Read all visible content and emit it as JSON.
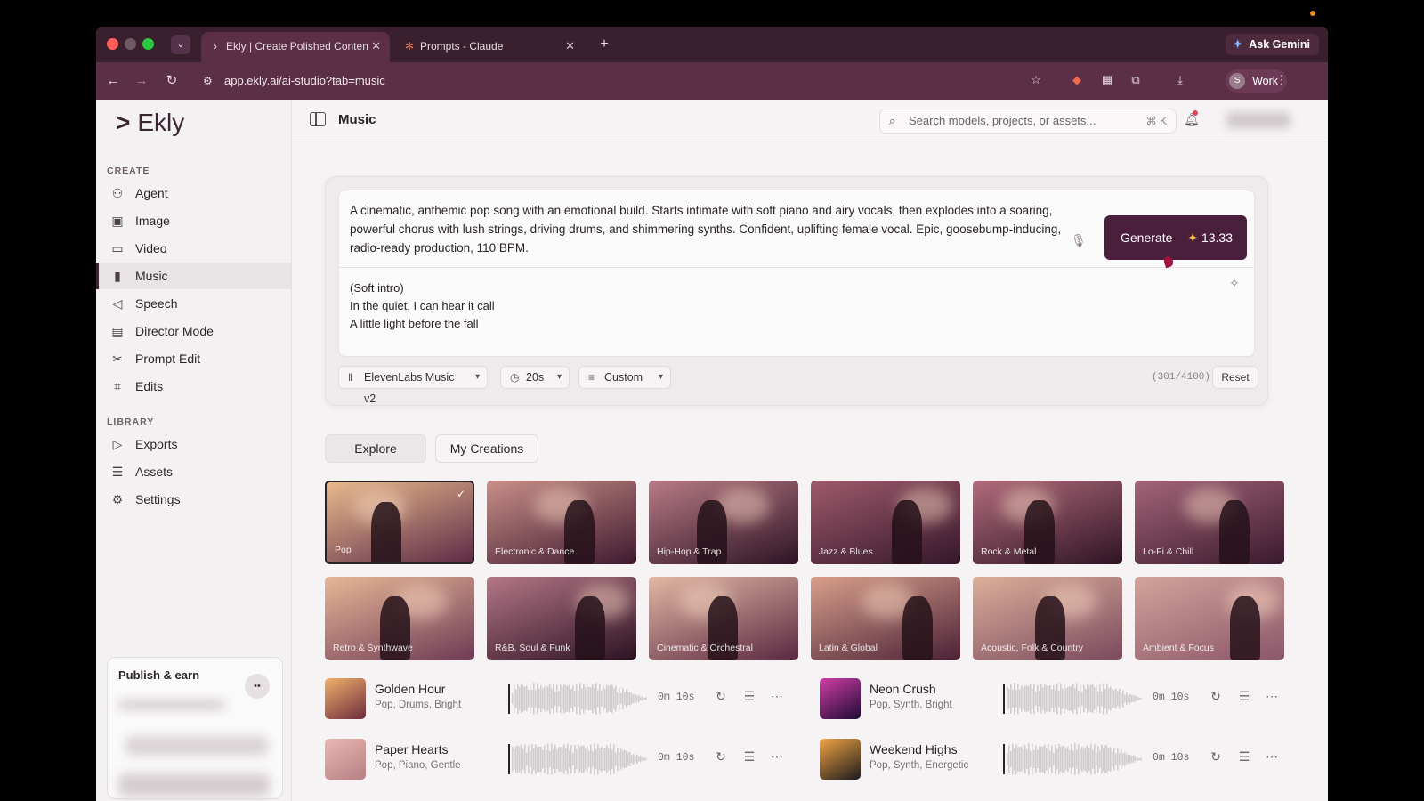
{
  "browser": {
    "tabs": [
      {
        "title": "Ekly | Create Polished Content",
        "icon": "ekly-favicon"
      },
      {
        "title": "Prompts - Claude",
        "icon": "claude-favicon"
      }
    ],
    "gemini_label": "Ask Gemini",
    "url": "app.ekly.ai/ai-studio?tab=music",
    "profile_label": "Work",
    "profile_initial": "S"
  },
  "sidebar": {
    "logo": "Ekly",
    "create_title": "CREATE",
    "create_items": [
      {
        "label": "Agent",
        "icon": "robot-icon"
      },
      {
        "label": "Image",
        "icon": "image-icon"
      },
      {
        "label": "Video",
        "icon": "video-icon"
      },
      {
        "label": "Music",
        "icon": "waveform-icon",
        "active": true
      },
      {
        "label": "Speech",
        "icon": "speech-icon"
      },
      {
        "label": "Director Mode",
        "icon": "clapperboard-icon"
      },
      {
        "label": "Prompt Edit",
        "icon": "scissors-icon"
      },
      {
        "label": "Edits",
        "icon": "crop-icon"
      }
    ],
    "library_title": "LIBRARY",
    "library_items": [
      {
        "label": "Exports",
        "icon": "play-icon"
      },
      {
        "label": "Assets",
        "icon": "database-icon"
      },
      {
        "label": "Settings",
        "icon": "gear-icon"
      }
    ],
    "publish_title": "Publish & earn"
  },
  "header": {
    "title": "Music",
    "search_placeholder": "Search models, projects, or assets...",
    "search_shortcut": "⌘ K"
  },
  "prompt": {
    "text": "A cinematic, anthemic pop song with an emotional build. Starts intimate with soft piano and airy vocals, then explodes into a soaring, powerful chorus with lush strings, driving drums, and shimmering synths. Confident, uplifting female vocal. Epic, goosebump-inducing, radio-ready production, 110 BPM.",
    "lyrics": [
      "(Soft intro)",
      "In the quiet, I can hear it call",
      "A little light before the fall"
    ],
    "generate_label": "Generate",
    "generate_cost": "13.33",
    "model": "ElevenLabs Music v2",
    "duration": "20s",
    "mode": "Custom",
    "counter": "(301/4100)",
    "reset_label": "Reset"
  },
  "explore": {
    "tabs": [
      {
        "label": "Explore",
        "active": true
      },
      {
        "label": "My Creations",
        "active": false
      }
    ],
    "genres": [
      {
        "label": "Pop",
        "selected": true,
        "colors": [
          "#e9b98d",
          "#5e2b46"
        ]
      },
      {
        "label": "Electronic & Dance",
        "colors": [
          "#c98e88",
          "#3e1a2f"
        ]
      },
      {
        "label": "Hip-Hop & Trap",
        "colors": [
          "#b87a86",
          "#2e1424"
        ]
      },
      {
        "label": "Jazz & Blues",
        "colors": [
          "#9e5a6c",
          "#35172a"
        ]
      },
      {
        "label": "Rock & Metal",
        "colors": [
          "#b16b7c",
          "#2f1424"
        ]
      },
      {
        "label": "Lo-Fi & Chill",
        "colors": [
          "#a46479",
          "#3a1a2d"
        ]
      },
      {
        "label": "Retro & Synthwave",
        "colors": [
          "#e7b796",
          "#6f3a55"
        ]
      },
      {
        "label": "R&B, Soul & Funk",
        "colors": [
          "#b47687",
          "#2c1322"
        ]
      },
      {
        "label": "Cinematic & Orchestral",
        "colors": [
          "#e2b8a4",
          "#5a2841"
        ]
      },
      {
        "label": "Latin & Global",
        "colors": [
          "#d99f8b",
          "#4a2136"
        ]
      },
      {
        "label": "Acoustic, Folk & Country",
        "colors": [
          "#dcae99",
          "#7a4a5e"
        ]
      },
      {
        "label": "Ambient & Focus",
        "colors": [
          "#d4a39a",
          "#8b566a"
        ]
      }
    ]
  },
  "tracks": [
    {
      "title": "Golden Hour",
      "tags": "Pop, Drums, Bright",
      "time": "0m 10s",
      "colors": [
        "#f0b16c",
        "#6d2c3c"
      ]
    },
    {
      "title": "Neon Crush",
      "tags": "Pop, Synth, Bright",
      "time": "0m 10s",
      "colors": [
        "#d03ea5",
        "#1e0b33"
      ]
    },
    {
      "title": "Paper Hearts",
      "tags": "Pop, Piano, Gentle",
      "time": "0m 10s",
      "colors": [
        "#eab7b3",
        "#b77f83"
      ]
    },
    {
      "title": "Weekend Highs",
      "tags": "Pop, Synth, Energetic",
      "time": "0m 10s",
      "colors": [
        "#f2a543",
        "#1c1a1c"
      ]
    }
  ]
}
